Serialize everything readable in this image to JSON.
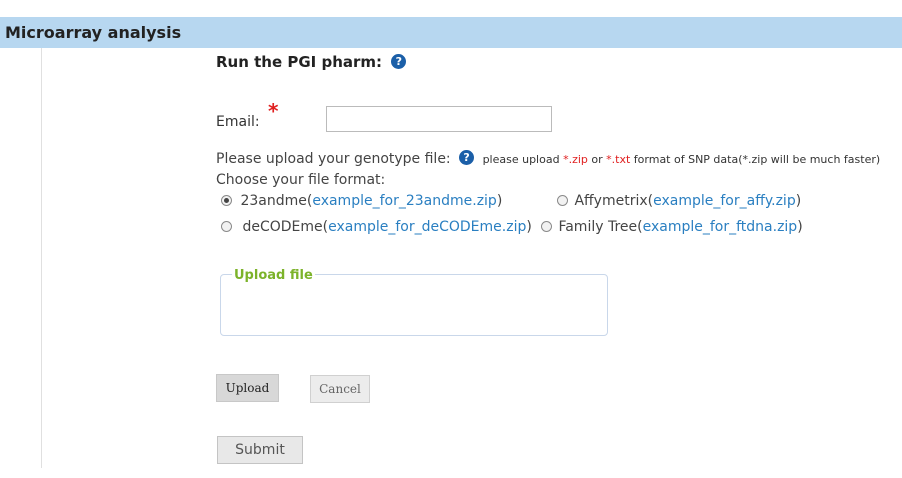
{
  "header": {
    "title": "Microarray analysis"
  },
  "page": {
    "title": "Run the PGI pharm:"
  },
  "email": {
    "label": "Email:",
    "required_mark": "*",
    "value": ""
  },
  "upload": {
    "prompt": "Please upload your genotype file:",
    "hint_prefix": "please upload",
    "ext_zip": "*.zip",
    "hint_or": "or",
    "ext_txt": "*.txt",
    "hint_suffix": "format of SNP data(*.zip will be much faster)"
  },
  "format": {
    "label": "Choose your file format:",
    "options": [
      {
        "name": "23andme",
        "link": "example_for_23andme.zip",
        "checked": true
      },
      {
        "name": "Affymetrix",
        "link": "example_for_affy.zip",
        "checked": false
      },
      {
        "name": "deCODEme",
        "link": "example_for_deCODEme.zip",
        "checked": false
      },
      {
        "name": "Family Tree",
        "link": "example_for_ftdna.zip",
        "checked": false
      }
    ]
  },
  "upload_box": {
    "legend": "Upload file"
  },
  "buttons": {
    "upload": "Upload",
    "cancel": "Cancel",
    "submit": "Submit"
  },
  "icons": {
    "help": "help-icon",
    "help_glyph": "?"
  },
  "colors": {
    "header_bg": "#b7d7f0",
    "link": "#2a7fc1",
    "required": "#e02020",
    "legend": "#7cb32a",
    "help_icon": "#1b5fa8"
  }
}
